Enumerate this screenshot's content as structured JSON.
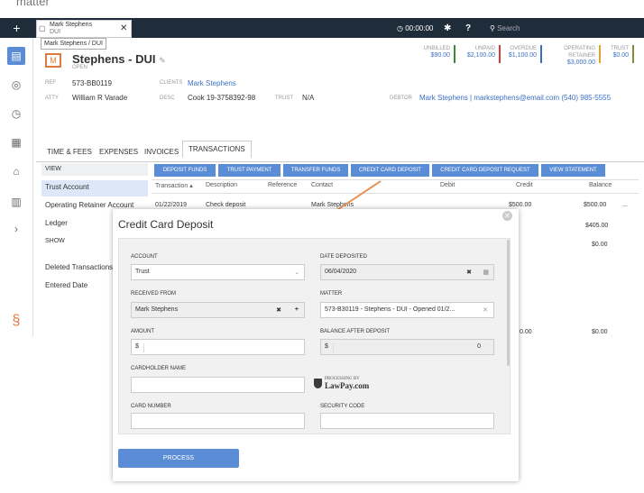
{
  "caption": "matter",
  "topbar": {
    "tab_title": "Mark Stephens",
    "tab_sub": "DUI",
    "tooltip": "Mark Stephens / DUI",
    "timer": "00:00:00",
    "search_placeholder": "Search"
  },
  "stats": [
    {
      "label": "UNBILLED",
      "value": "$90.00"
    },
    {
      "label": "UNPAID",
      "value": "$2,100.00"
    },
    {
      "label": "OVERDUE",
      "value": "$1,100.00"
    },
    {
      "label": "OPERATING RETAINER",
      "value": "$3,000.00"
    },
    {
      "label": "TRUST",
      "value": "$0.00"
    }
  ],
  "matter": {
    "title": "Stephens - DUI",
    "status": "OPEN",
    "ref_label": "REF",
    "ref": "573-BB0119",
    "atty_label": "ATTY",
    "atty": "William R Varade",
    "clients_label": "CLIENTS",
    "clients": "Mark Stephens",
    "desc_label": "DESC",
    "desc": "Cook 19-3758392-98",
    "trust_label": "TRUST",
    "trust": "N/A",
    "debtor_label": "DEBTOR",
    "debtor": "Mark Stephens | markstephens@email.com (540) 985-5555"
  },
  "tabs": [
    "TIME & FEES",
    "EXPENSES",
    "INVOICES",
    "TRANSACTIONS"
  ],
  "left": {
    "view": "VIEW",
    "items": [
      "Trust Account",
      "Operating Retainer Account",
      "Ledger"
    ],
    "show": "SHOW",
    "show_items": [
      "Deleted Transactions",
      "Entered Date"
    ]
  },
  "actions": [
    "DEPOSIT FUNDS",
    "TRUST PAYMENT",
    "TRANSFER FUNDS",
    "CREDIT CARD DEPOSIT",
    "CREDIT CARD DEPOSIT REQUEST",
    "VIEW STATEMENT"
  ],
  "table": {
    "headers": [
      "Transaction",
      "Description",
      "Reference",
      "Contact",
      "Debit",
      "Credit",
      "Balance"
    ],
    "row1": {
      "date": "01/22/2019",
      "desc": "Check deposit",
      "contact": "Mark Stephens",
      "credit": "$500.00",
      "balance": "$500.00",
      "more": "..."
    },
    "balances": [
      "$405.00",
      "$0.00"
    ],
    "footer_credit": "0.00",
    "footer_balance": "$0.00"
  },
  "modal": {
    "title": "Credit Card Deposit",
    "account_label": "ACCOUNT",
    "account": "Trust",
    "date_label": "DATE DEPOSITED",
    "date": "06/04/2020",
    "received_label": "RECEIVED FROM",
    "received": "Mark Stephens",
    "matter_label": "MATTER",
    "matter": "573-B30119 - Stephens - DUI - Opened 01/2...",
    "amount_label": "AMOUNT",
    "amount_prefix": "$",
    "balance_label": "BALANCE AFTER DEPOSIT",
    "balance_prefix": "$",
    "balance": "0",
    "cardholder_label": "CARDHOLDER NAME",
    "lawpay_small": "PROCESSING BY",
    "lawpay_big": "LawPay.com",
    "card_label": "CARD NUMBER",
    "security_label": "SECURITY CODE",
    "process": "PROCESS"
  },
  "colors": {
    "accent": "#5b8dd6",
    "nav": "#1f2d3a",
    "matter_icon": "#e07a3c"
  }
}
